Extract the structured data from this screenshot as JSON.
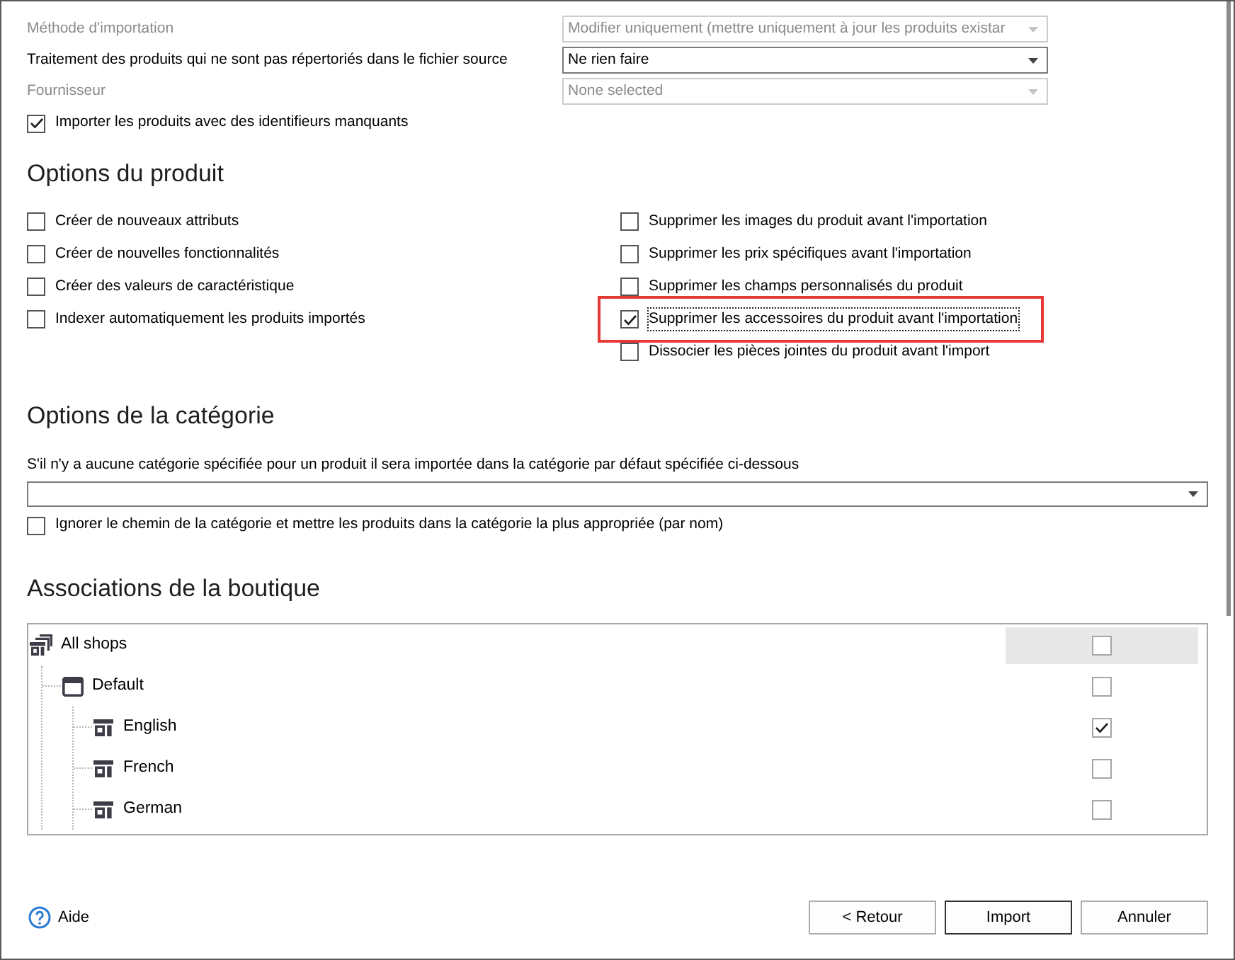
{
  "import_settings": [
    {
      "label": "Méthode d'importation",
      "value": "Modifier uniquement (mettre uniquement à jour les produits existar",
      "disabled": true
    },
    {
      "label": "Traitement des produits qui ne sont pas répertoriés dans le fichier source",
      "value": "Ne rien faire",
      "disabled": false
    },
    {
      "label": "Fournisseur",
      "value": "None selected",
      "disabled": true
    }
  ],
  "import_missing_identifiers": {
    "label": "Importer les produits avec des identifieurs manquants",
    "checked": true
  },
  "product_options": {
    "title": "Options du produit",
    "left": [
      {
        "label": "Créer de nouveaux attributs",
        "checked": false
      },
      {
        "label": "Créer de nouvelles fonctionnalités",
        "checked": false
      },
      {
        "label": "Créer des valeurs de caractéristique",
        "checked": false
      },
      {
        "label": "Indexer automatiquement les produits importés",
        "checked": false
      }
    ],
    "right": [
      {
        "label": "Supprimer les images du produit avant l'importation",
        "checked": false,
        "highlighted": false,
        "focused": false
      },
      {
        "label": "Supprimer les prix spécifiques avant l'importation",
        "checked": false,
        "highlighted": false,
        "focused": false
      },
      {
        "label": "Supprimer les champs personnalisés du produit",
        "checked": false,
        "highlighted": false,
        "focused": false
      },
      {
        "label": "Supprimer les accessoires du produit avant l'importation",
        "checked": true,
        "highlighted": true,
        "focused": true
      },
      {
        "label": "Dissocier les pièces jointes du produit avant l'import",
        "checked": false,
        "highlighted": false,
        "focused": false
      }
    ]
  },
  "category_options": {
    "title": "Options de la catégorie",
    "dropdown_label": "S'il n'y a aucune catégorie spécifiée pour un produit il sera importée dans la catégorie par défaut spécifiée ci-dessous",
    "ignore_path": {
      "label": "Ignorer le chemin de la catégorie et mettre les produits dans la catégorie la plus appropriée (par nom)",
      "checked": false
    }
  },
  "shop_associations": {
    "title": "Associations de la boutique",
    "tree": [
      {
        "label": "All shops",
        "kind": "all-shops",
        "checked": false,
        "selected": true,
        "children": [
          {
            "label": "Default",
            "kind": "shop-group",
            "checked": false,
            "selected": false,
            "children": [
              {
                "label": "English",
                "kind": "shop",
                "checked": true,
                "selected": false
              },
              {
                "label": "French",
                "kind": "shop",
                "checked": false,
                "selected": false
              },
              {
                "label": "German",
                "kind": "shop",
                "checked": false,
                "selected": false
              }
            ]
          }
        ]
      }
    ]
  },
  "footer": {
    "help": "Aide",
    "buttons": [
      {
        "label": "< Retour",
        "default": false
      },
      {
        "label": "Import",
        "default": true
      },
      {
        "label": "Annuler",
        "default": false
      }
    ]
  }
}
